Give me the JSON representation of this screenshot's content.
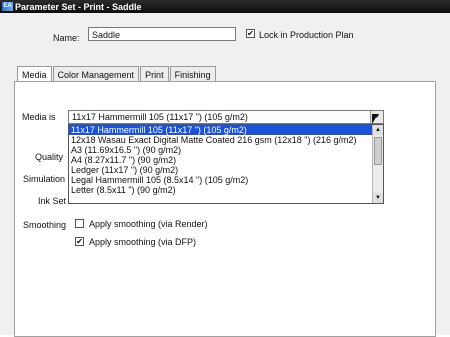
{
  "window": {
    "title": "Parameter Set - Print - Saddle",
    "icon_text": "EA"
  },
  "name_field": {
    "label": "Name:",
    "value": "Saddle"
  },
  "lock": {
    "label": "Lock in Production Plan",
    "checked": true
  },
  "tabs": [
    {
      "label": "Media",
      "active": true
    },
    {
      "label": "Color Management",
      "active": false
    },
    {
      "label": "Print",
      "active": false
    },
    {
      "label": "Finishing",
      "active": false
    }
  ],
  "media": {
    "label": "Media is",
    "selected": "11x17 Hammermill 105 (11x17 \") (105 g/m2)",
    "options": [
      "11x17 Hammermill 105 (11x17 \") (105 g/m2)",
      "12x18 Wasau Exact Digital Matte Coated 216 gsm (12x18 \") (216 g/m2)",
      "A3 (11.69x16.5 \") (90 g/m2)",
      "A4 (8.27x11.7 \") (90 g/m2)",
      "Ledger (11x17 \") (90 g/m2)",
      "Legal Hammermill 105 (8.5x14 \") (105 g/m2)",
      "Letter (8.5x11 \") (90 g/m2)"
    ],
    "highlighted_index": 0
  },
  "labels": {
    "quality": "Quality",
    "simulation": "Simulation",
    "ink_set": "Ink Set",
    "smoothing": "Smoothing"
  },
  "smoothing": [
    {
      "label": "Apply smoothing (via Render)",
      "checked": false
    },
    {
      "label": "Apply smoothing (via DFP)",
      "checked": true
    }
  ],
  "colors": {
    "titlebar": "#111111",
    "highlight": "#1a53d8",
    "panel": "#f0f0f0"
  }
}
